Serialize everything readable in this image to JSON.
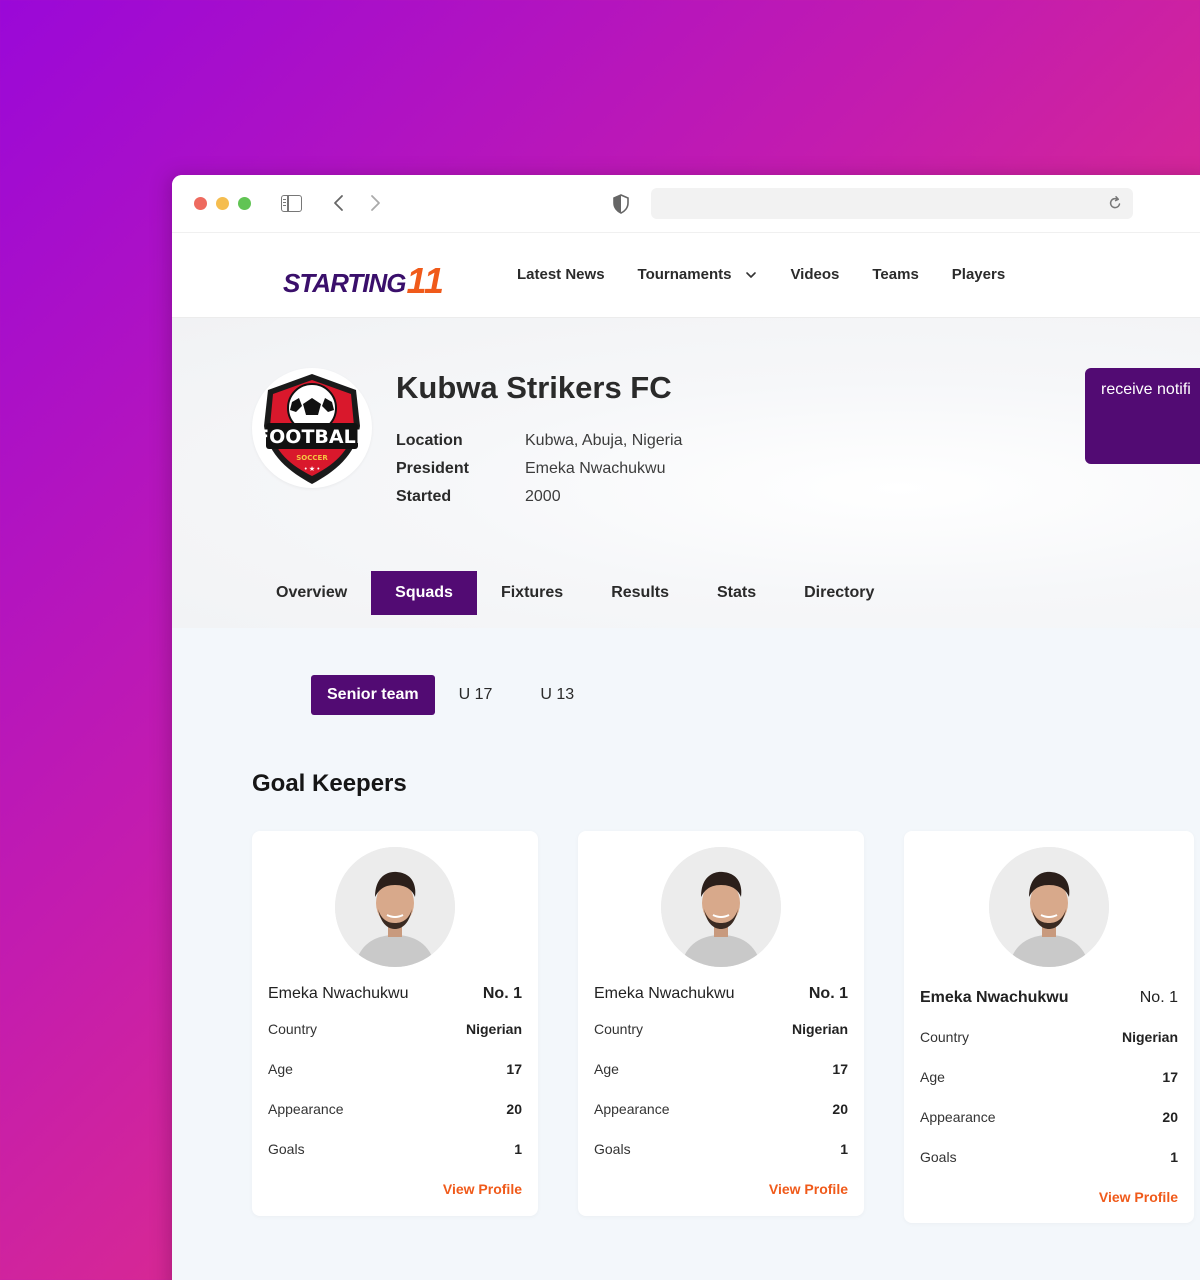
{
  "brand": {
    "logo_main": "STARTING",
    "logo_number": "11"
  },
  "nav": {
    "items": [
      "Latest News",
      "Tournaments",
      "Videos",
      "Teams",
      "Players"
    ]
  },
  "club": {
    "name": "Kubwa Strikers FC",
    "logo_text": "FOOTBALL",
    "logo_subtext": "SOCCER",
    "details": [
      {
        "label": "Location",
        "value": "Kubwa, Abuja, Nigeria"
      },
      {
        "label": "President",
        "value": "Emeka Nwachukwu"
      },
      {
        "label": "Started",
        "value": "2000"
      }
    ],
    "notify_button": "receive notifi"
  },
  "tabs": [
    "Overview",
    "Squads",
    "Fixtures",
    "Results",
    "Stats",
    "Directory"
  ],
  "active_tab": "Squads",
  "subtabs": [
    "Senior team",
    "U 17",
    "U 13"
  ],
  "active_subtab": "Senior team",
  "section_title": "Goal Keepers",
  "players": [
    {
      "name": "Emeka Nwachukwu",
      "number": "No. 1",
      "stats": [
        {
          "label": "Country",
          "value": "Nigerian"
        },
        {
          "label": "Age",
          "value": "17"
        },
        {
          "label": "Appearance",
          "value": "20"
        },
        {
          "label": "Goals",
          "value": "1"
        }
      ],
      "link": "View Profile"
    },
    {
      "name": "Emeka Nwachukwu",
      "number": "No. 1",
      "stats": [
        {
          "label": "Country",
          "value": "Nigerian"
        },
        {
          "label": "Age",
          "value": "17"
        },
        {
          "label": "Appearance",
          "value": "20"
        },
        {
          "label": "Goals",
          "value": "1"
        }
      ],
      "link": "View Profile"
    },
    {
      "name": "Emeka Nwachukwu",
      "number": "No. 1",
      "stats": [
        {
          "label": "Country",
          "value": "Nigerian"
        },
        {
          "label": "Age",
          "value": "17"
        },
        {
          "label": "Appearance",
          "value": "20"
        },
        {
          "label": "Goals",
          "value": "1"
        }
      ],
      "link": "View Profile"
    }
  ],
  "colors": {
    "primary": "#520b73",
    "accent": "#f05a1a",
    "page_bg": "#f3f7fb"
  }
}
